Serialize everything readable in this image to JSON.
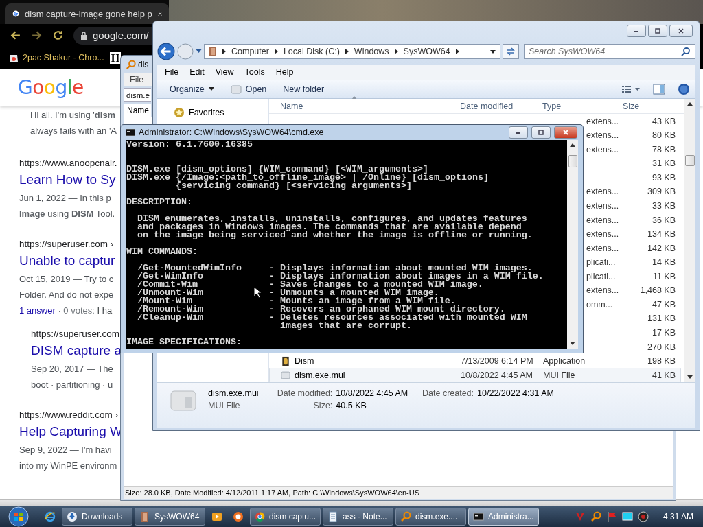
{
  "browser": {
    "tab_title": "dism capture-image gone help p",
    "address": "google.com/",
    "bookmark": "2pac Shakur - Chro...",
    "bookmark_2_glyph": "H",
    "logo": "Google",
    "snippet": [
      "Hi all. I'm using '**dism**",
      "always fails with an 'A"
    ],
    "results": [
      {
        "url": "https://www.anoopcnair.",
        "title": "Learn How to Sy",
        "lines": [
          "Jun 1, 2022 — In this p",
          "**Image** using **DISM** Tool."
        ]
      },
      {
        "url": "https://superuser.com ›",
        "title": "Unable to captur",
        "lines": [
          "Oct 15, 2019 — Try to c",
          "Folder. And do not expe"
        ],
        "answers": {
          "link": "1 answer",
          "meta": "· 0 votes:",
          "text": "I ha"
        },
        "children": [
          {
            "url": "https://superuser.com",
            "title": "DISM capture a",
            "lines": [
              "Sep 20, 2017 — The",
              "boot · partitioning · u"
            ]
          }
        ]
      },
      {
        "url": "https://www.reddit.com ›",
        "title": "Help Capturing W",
        "lines": [
          "Sep 9, 2022 — I'm havi",
          "into my WinPE environm"
        ]
      }
    ]
  },
  "search_window": {
    "title": "dis",
    "menu": [
      "File"
    ],
    "search_value": "dism.e",
    "column": "Name",
    "status": "Size: 28.0 KB, Date Modified: 4/12/2011 1:17 AM, Path: C:\\Windows\\SysWOW64\\en-US"
  },
  "explorer": {
    "breadcrumb": [
      "Computer",
      "Local Disk (C:)",
      "Windows",
      "SysWOW64"
    ],
    "search_placeholder": "Search SysWOW64",
    "menu": [
      "File",
      "Edit",
      "View",
      "Tools",
      "Help"
    ],
    "toolbar": [
      {
        "label": "Organize",
        "kind": "menu"
      },
      {
        "label": "Open",
        "kind": "open"
      },
      {
        "label": "New folder",
        "kind": "plain"
      }
    ],
    "nav": [
      "Favorites"
    ],
    "columns": [
      "Name",
      "Date modified",
      "Type",
      "Size"
    ],
    "rows": [
      {
        "type": "extens...",
        "size": "43 KB",
        "selected": false
      },
      {
        "type": "extens...",
        "size": "80 KB",
        "selected": false
      },
      {
        "type": "extens...",
        "size": "78 KB",
        "selected": false
      },
      {
        "size": "31 KB",
        "selected": false
      },
      {
        "size": "93 KB",
        "selected": false
      },
      {
        "type": "extens...",
        "size": "309 KB",
        "selected": false
      },
      {
        "type": "extens...",
        "size": "33 KB",
        "selected": false
      },
      {
        "type": "extens...",
        "size": "36 KB",
        "selected": false
      },
      {
        "type": "extens...",
        "size": "134 KB",
        "selected": false
      },
      {
        "type": "extens...",
        "size": "142 KB",
        "selected": false
      },
      {
        "type": "plicati...",
        "size": "14 KB",
        "selected": false
      },
      {
        "type": "plicati...",
        "size": "11 KB",
        "selected": false
      },
      {
        "type": "extens...",
        "size": "1,468 KB",
        "selected": false
      },
      {
        "type": "omm...",
        "size": "47 KB",
        "selected": false
      },
      {
        "size": "131 KB",
        "selected": false
      },
      {
        "size": "17 KB",
        "selected": false
      },
      {
        "size": "270 KB",
        "selected": false
      },
      {
        "name": "Dism",
        "date": "7/13/2009 6:14 PM",
        "type": "Application",
        "size": "198 KB",
        "kind": "app",
        "selected": false
      },
      {
        "name": "dism.exe.mui",
        "date": "10/8/2022 4:45 AM",
        "type": "MUI File",
        "size": "41 KB",
        "kind": "file",
        "selected": true
      }
    ],
    "details": {
      "name": "dism.exe.mui",
      "type": "MUI File",
      "modified_label": "Date modified:",
      "modified": "10/8/2022 4:45 AM",
      "size_label": "Size:",
      "size": "40.5 KB",
      "created_label": "Date created:",
      "created": "10/22/2022 4:31 AM"
    }
  },
  "cmd": {
    "title": "Administrator: C:\\Windows\\SysWOW64\\cmd.exe",
    "blocks": [
      {
        "kind": "plain",
        "lines": [
          "Version: 6.1.7600.16385"
        ]
      },
      {
        "kind": "usage",
        "lines": [
          "DISM.exe [dism_options] {WIM_command} [<WIM_arguments>]",
          "DISM.exe {/Image:<path_to_offline_image> | /Online} [dism_options]",
          "{servicing_command} [<servicing_arguments>]"
        ]
      },
      {
        "kind": "plain",
        "lines": [
          "DESCRIPTION:"
        ]
      },
      {
        "kind": "indent",
        "lines": [
          "DISM enumerates, installs, uninstalls, configures, and updates features",
          "and packages in Windows images. The commands that are available depend",
          "on the image being serviced and whether the image is offline or running."
        ]
      },
      {
        "kind": "plain",
        "lines": [
          "WIM COMMANDS:"
        ]
      }
    ],
    "commands": [
      {
        "command": "/Get-MountedWimInfo",
        "separator": "-",
        "description": "Displays information about mounted WIM images."
      },
      {
        "command": "/Get-WimInfo",
        "separator": "-",
        "description": "Displays information about images in a WIM file."
      },
      {
        "command": "/Commit-Wim",
        "separator": "-",
        "description": "Saves changes to a mounted WIM image."
      },
      {
        "command": "/Unmount-Wim",
        "separator": "-",
        "description": "Unmounts a mounted WIM image."
      },
      {
        "command": "/Mount-Wim",
        "separator": "-",
        "description": "Mounts an image from a WIM file."
      },
      {
        "command": "/Remount-Wim",
        "separator": "-",
        "description": "Recovers an orphaned WIM mount directory."
      },
      {
        "command": "/Cleanup-Wim",
        "separator": "-",
        "description": "Deletes resources associated with mounted WIM images that are corrupt."
      }
    ],
    "footer": "IMAGE SPECIFICATIONS:"
  },
  "taskbar": {
    "items": [
      {
        "kind": "ie",
        "selected": false
      },
      {
        "kind": "folder",
        "label": "Downloads",
        "selected": false
      },
      {
        "kind": "explorer",
        "label": "SysWOW64",
        "selected": false
      },
      {
        "kind": "media",
        "selected": false
      },
      {
        "kind": "uc",
        "selected": false
      },
      {
        "kind": "chrome",
        "label": "dism captu...",
        "selected": false
      },
      {
        "kind": "notepad",
        "label": "ass - Note...",
        "selected": false
      },
      {
        "kind": "search",
        "label": "dism.exe....",
        "selected": false
      },
      {
        "kind": "cmd",
        "label": "Administra...",
        "selected": true
      }
    ],
    "clock": "4:31 AM"
  }
}
